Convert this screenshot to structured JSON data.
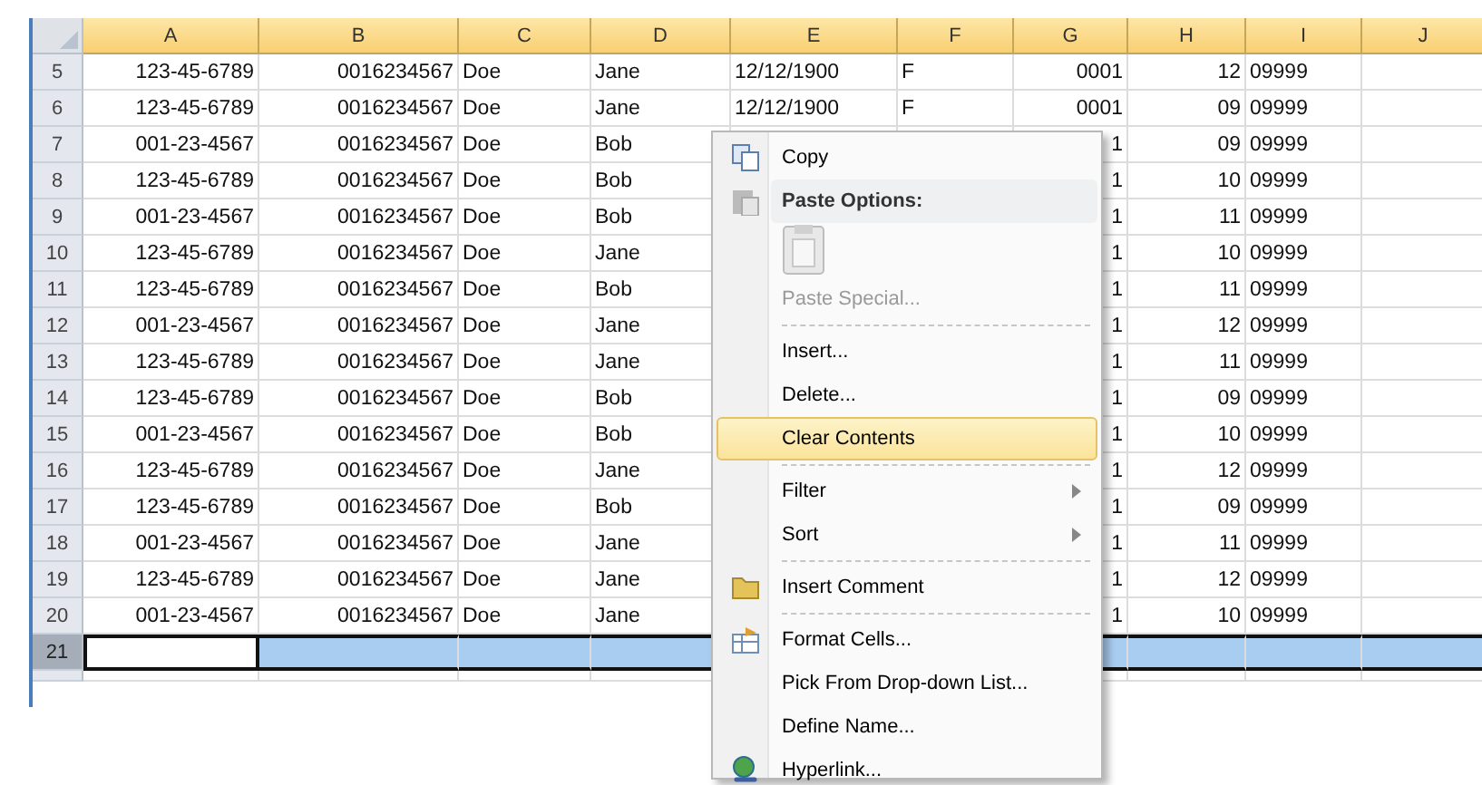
{
  "columns": [
    "A",
    "B",
    "C",
    "D",
    "E",
    "F",
    "G",
    "H",
    "I",
    "J"
  ],
  "rows": [
    {
      "number": "5",
      "selected": false,
      "cells": {
        "a": "123-45-6789",
        "b": "0016234567",
        "c": "Doe",
        "d": "Jane",
        "e": "12/12/1900",
        "f": "F",
        "g": "0001",
        "h": "12",
        "i": "09999"
      }
    },
    {
      "number": "6",
      "selected": false,
      "cells": {
        "a": "123-45-6789",
        "b": "0016234567",
        "c": "Doe",
        "d": "Jane",
        "e": "12/12/1900",
        "f": "F",
        "g": "0001",
        "h": "09",
        "i": "09999"
      }
    },
    {
      "number": "7",
      "selected": false,
      "cells": {
        "a": "001-23-4567",
        "b": "0016234567",
        "c": "Doe",
        "d": "Bob",
        "g": "1",
        "h": "09",
        "i": "09999"
      }
    },
    {
      "number": "8",
      "selected": false,
      "cells": {
        "a": "123-45-6789",
        "b": "0016234567",
        "c": "Doe",
        "d": "Bob",
        "g": "1",
        "h": "10",
        "i": "09999"
      }
    },
    {
      "number": "9",
      "selected": false,
      "cells": {
        "a": "001-23-4567",
        "b": "0016234567",
        "c": "Doe",
        "d": "Bob",
        "g": "1",
        "h": "11",
        "i": "09999"
      }
    },
    {
      "number": "10",
      "selected": false,
      "cells": {
        "a": "123-45-6789",
        "b": "0016234567",
        "c": "Doe",
        "d": "Jane",
        "g": "1",
        "h": "10",
        "i": "09999"
      }
    },
    {
      "number": "11",
      "selected": false,
      "cells": {
        "a": "123-45-6789",
        "b": "0016234567",
        "c": "Doe",
        "d": "Bob",
        "g": "1",
        "h": "11",
        "i": "09999"
      }
    },
    {
      "number": "12",
      "selected": false,
      "cells": {
        "a": "001-23-4567",
        "b": "0016234567",
        "c": "Doe",
        "d": "Jane",
        "g": "1",
        "h": "12",
        "i": "09999"
      }
    },
    {
      "number": "13",
      "selected": false,
      "cells": {
        "a": "123-45-6789",
        "b": "0016234567",
        "c": "Doe",
        "d": "Jane",
        "g": "1",
        "h": "11",
        "i": "09999"
      }
    },
    {
      "number": "14",
      "selected": false,
      "cells": {
        "a": "123-45-6789",
        "b": "0016234567",
        "c": "Doe",
        "d": "Bob",
        "g": "1",
        "h": "09",
        "i": "09999"
      }
    },
    {
      "number": "15",
      "selected": false,
      "cells": {
        "a": "001-23-4567",
        "b": "0016234567",
        "c": "Doe",
        "d": "Bob",
        "g": "1",
        "h": "10",
        "i": "09999"
      }
    },
    {
      "number": "16",
      "selected": false,
      "cells": {
        "a": "123-45-6789",
        "b": "0016234567",
        "c": "Doe",
        "d": "Jane",
        "g": "1",
        "h": "12",
        "i": "09999"
      }
    },
    {
      "number": "17",
      "selected": false,
      "cells": {
        "a": "123-45-6789",
        "b": "0016234567",
        "c": "Doe",
        "d": "Bob",
        "g": "1",
        "h": "09",
        "i": "09999"
      }
    },
    {
      "number": "18",
      "selected": false,
      "cells": {
        "a": "001-23-4567",
        "b": "0016234567",
        "c": "Doe",
        "d": "Jane",
        "g": "1",
        "h": "11",
        "i": "09999"
      }
    },
    {
      "number": "19",
      "selected": false,
      "cells": {
        "a": "123-45-6789",
        "b": "0016234567",
        "c": "Doe",
        "d": "Jane",
        "g": "1",
        "h": "12",
        "i": "09999"
      }
    },
    {
      "number": "20",
      "selected": false,
      "cells": {
        "a": "001-23-4567",
        "b": "0016234567",
        "c": "Doe",
        "d": "Jane",
        "g": "1",
        "h": "10",
        "i": "09999"
      }
    },
    {
      "number": "21",
      "selected": true,
      "cells": {}
    }
  ],
  "context_menu": [
    {
      "kind": "item",
      "label": "Copy",
      "disabled": false,
      "highlighted": false,
      "submenu": false
    },
    {
      "kind": "header",
      "label": "Paste Options:"
    },
    {
      "kind": "paste-icons"
    },
    {
      "kind": "item",
      "label": "Paste Special...",
      "disabled": true,
      "highlighted": false,
      "submenu": false
    },
    {
      "kind": "separator"
    },
    {
      "kind": "item",
      "label": "Insert...",
      "disabled": false,
      "highlighted": false,
      "submenu": false
    },
    {
      "kind": "item",
      "label": "Delete...",
      "disabled": false,
      "highlighted": false,
      "submenu": false
    },
    {
      "kind": "item",
      "label": "Clear Contents",
      "disabled": false,
      "highlighted": true,
      "submenu": false
    },
    {
      "kind": "separator"
    },
    {
      "kind": "item",
      "label": "Filter",
      "disabled": false,
      "highlighted": false,
      "submenu": true
    },
    {
      "kind": "item",
      "label": "Sort",
      "disabled": false,
      "highlighted": false,
      "submenu": true
    },
    {
      "kind": "separator"
    },
    {
      "kind": "item",
      "label": "Insert Comment",
      "disabled": false,
      "highlighted": false,
      "submenu": false
    },
    {
      "kind": "separator"
    },
    {
      "kind": "item",
      "label": "Format Cells...",
      "disabled": false,
      "highlighted": false,
      "submenu": false
    },
    {
      "kind": "item",
      "label": "Pick From Drop-down List...",
      "disabled": false,
      "highlighted": false,
      "submenu": false
    },
    {
      "kind": "item",
      "label": "Define Name...",
      "disabled": false,
      "highlighted": false,
      "submenu": false
    },
    {
      "kind": "item",
      "label": "Hyperlink...",
      "disabled": false,
      "highlighted": false,
      "submenu": false
    }
  ]
}
